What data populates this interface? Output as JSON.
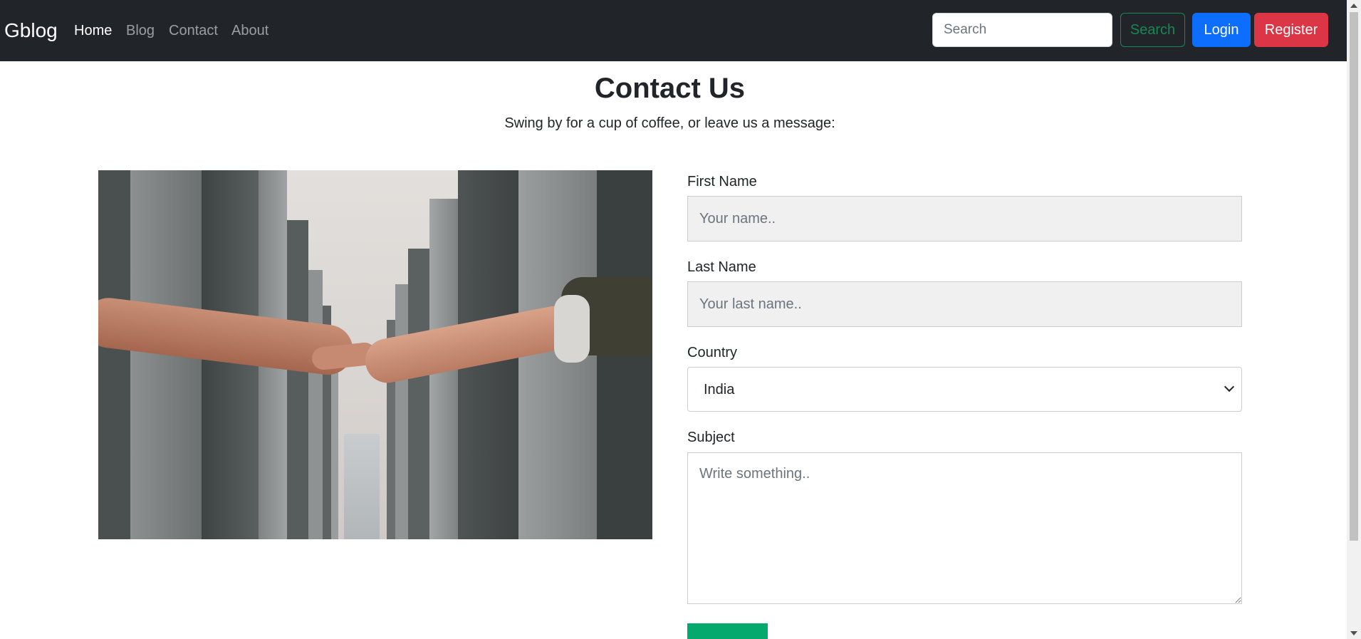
{
  "navbar": {
    "brand": "Gblog",
    "links": [
      {
        "label": "Home",
        "active": true
      },
      {
        "label": "Blog",
        "active": false
      },
      {
        "label": "Contact",
        "active": false
      },
      {
        "label": "About",
        "active": false
      }
    ],
    "search": {
      "placeholder": "Search",
      "button_label": "Search"
    },
    "login_label": "Login",
    "register_label": "Register"
  },
  "page": {
    "title": "Contact Us",
    "subtitle": "Swing by for a cup of coffee, or leave us a message:"
  },
  "form": {
    "first_name": {
      "label": "First Name",
      "placeholder": "Your name.."
    },
    "last_name": {
      "label": "Last Name",
      "placeholder": "Your last name.."
    },
    "country": {
      "label": "Country",
      "value": "India"
    },
    "subject": {
      "label": "Subject",
      "placeholder": "Write something.."
    }
  },
  "colors": {
    "navbar_bg": "#212529",
    "search_button": "#198754",
    "login_button": "#0d6efd",
    "register_button": "#dc3545",
    "submit_button": "#04aa6d"
  }
}
